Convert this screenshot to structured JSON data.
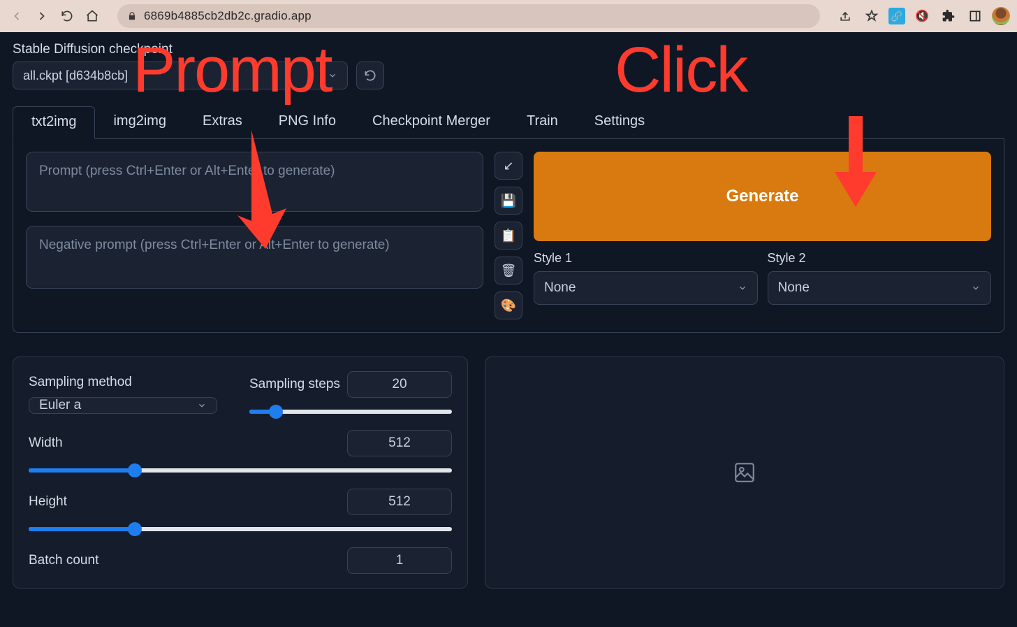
{
  "browser": {
    "url": "6869b4885cb2db2c.gradio.app"
  },
  "checkpoint": {
    "label": "Stable Diffusion checkpoint",
    "value": "all.ckpt [d634b8cb]"
  },
  "tabs": [
    "txt2img",
    "img2img",
    "Extras",
    "PNG Info",
    "Checkpoint Merger",
    "Train",
    "Settings"
  ],
  "active_tab": 0,
  "prompt": {
    "placeholder": "Prompt (press Ctrl+Enter or Alt+Enter to generate)"
  },
  "neg_prompt": {
    "placeholder": "Negative prompt (press Ctrl+Enter or Alt+Enter to generate)"
  },
  "generate": {
    "label": "Generate"
  },
  "style1": {
    "label": "Style 1",
    "value": "None"
  },
  "style2": {
    "label": "Style 2",
    "value": "None"
  },
  "sampling_method": {
    "label": "Sampling method",
    "value": "Euler a"
  },
  "sampling_steps": {
    "label": "Sampling steps",
    "value": "20",
    "pct": 13
  },
  "width": {
    "label": "Width",
    "value": "512",
    "pct": 25
  },
  "height": {
    "label": "Height",
    "value": "512",
    "pct": 25
  },
  "batch_count": {
    "label": "Batch count",
    "value": "1"
  },
  "icon_buttons": {
    "collapse": "↙",
    "save": "💾",
    "clipboard": "📋",
    "trash": "🗑",
    "palette": "🎨"
  },
  "annotations": {
    "prompt": "Prompt",
    "click": "Click"
  }
}
